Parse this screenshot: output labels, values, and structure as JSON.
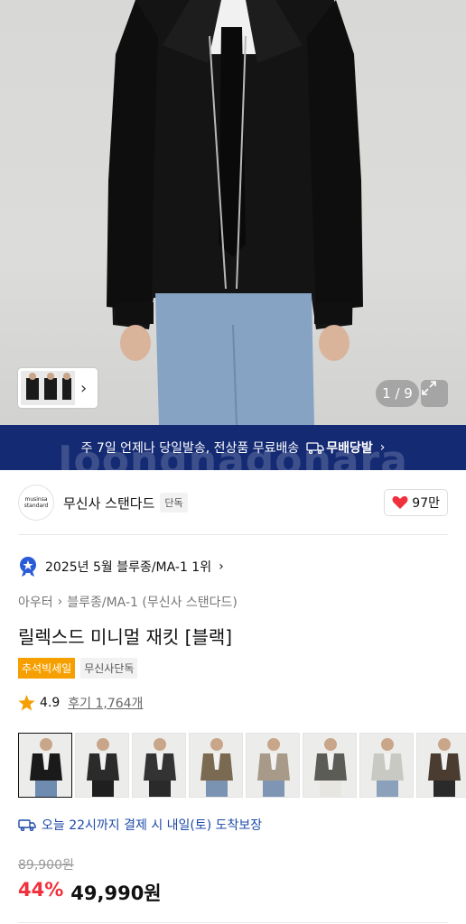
{
  "hero": {
    "counter": "1 / 9",
    "thumb_arrow": "chevron-right"
  },
  "banner": {
    "text": "주 7일 언제나 당일발송, 전상품 무료배송",
    "badge_label": "무배당발",
    "watermark": "Joongnagonara"
  },
  "brand": {
    "logo_line1": "musinsa",
    "logo_line2": "standard",
    "name": "무신사 스탠다드",
    "tag": "단독",
    "likes": "97만"
  },
  "ranking": {
    "text": "2025년 5월 블루종/MA-1 1위"
  },
  "breadcrumb": {
    "level1": "아우터",
    "level2": "블루종/MA-1 (무신사 스탠다드)"
  },
  "product": {
    "title": "릴렉스드 미니멀 재킷 [블랙]",
    "badge_sale": "추석빅세일",
    "badge_exclusive": "무신사단독",
    "rating": "4.9",
    "reviews": "후기 1,764개"
  },
  "colors": [
    {
      "name": "black",
      "jacket": "#1a1a1a",
      "pants": "#6e8bb0"
    },
    {
      "name": "charcoal",
      "jacket": "#2b2b2b",
      "pants": "#1f1f1f"
    },
    {
      "name": "dark-grey",
      "jacket": "#333333",
      "pants": "#2a2a2a"
    },
    {
      "name": "khaki",
      "jacket": "#7a6a52",
      "pants": "#7a93b3"
    },
    {
      "name": "beige",
      "jacket": "#a89a88",
      "pants": "#7e96b4"
    },
    {
      "name": "olive-grey",
      "jacket": "#5a5c55",
      "pants": "#e8e6e0"
    },
    {
      "name": "light-grey",
      "jacket": "#c9c9c3",
      "pants": "#8aa0bb"
    },
    {
      "name": "brown",
      "jacket": "#4a3c30",
      "pants": "#2a2a2a"
    }
  ],
  "delivery": {
    "text": "오늘 22시까지 결제 시 내일(토) 도착보장"
  },
  "price": {
    "original": "89,900원",
    "discount": "44%",
    "final": "49,990원"
  },
  "theme": {
    "banner_bg": "#142a73",
    "accent_red": "#f0303c",
    "sale_orange": "#f5a000",
    "link_blue": "#1e4aa8"
  }
}
